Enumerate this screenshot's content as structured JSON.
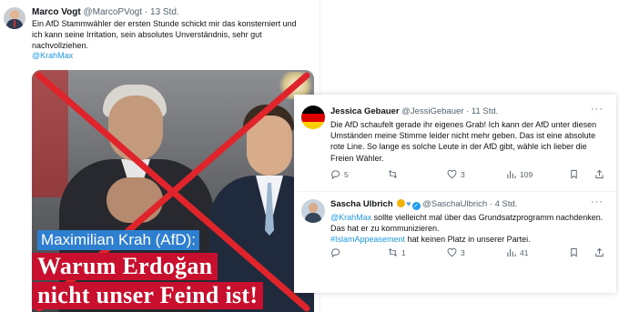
{
  "main_tweet": {
    "name": "Marco Vogt",
    "handle": "@MarcoPVogt",
    "time": "· 13 Std.",
    "text_lines": [
      "Ein AfD Stammwähler der ersten Stunde schickt mir das konsterniert und",
      "ich kann seine Irritation, sein absolutes Unverständnis, sehr gut",
      "nachvollziehen."
    ],
    "mention": "@KrahMax",
    "image": {
      "subtitle": "Maximilian Krah (AfD):",
      "headline_1": "Warum Erdoğan",
      "headline_2": "nicht unser Feind ist!",
      "cross_color": "#e0242b",
      "banner_red": "#c8102e",
      "banner_blue": "#2f7fd0"
    }
  },
  "replies": [
    {
      "name": "Jessica Gebauer",
      "handle": "@JessiGebauer",
      "time": "· 11 Std.",
      "avatar_icon": "german-flag-icon",
      "text_lines": [
        "Die AfD schaufelt gerade ihr eigenes Grab! Ich kann der AfD unter diesen",
        "Umständen meine Stimme leider nicht mehr geben. Das ist eine absolute",
        "rote Line. So lange es solche Leute in der AfD gibt, wähle ich lieber die",
        "Freien Wähler."
      ],
      "actions": {
        "replies": "5",
        "reposts": "",
        "likes": "3",
        "views": "109"
      }
    },
    {
      "name": "Sascha Ulbrich",
      "handle": "@SaschaUlbrich",
      "time": "· 4 Std.",
      "avatar_icon": "user-avatar-icon",
      "line1_mention": "@KrahMax",
      "line1_rest": " sollte vielleicht mal über das Grundsatzprogramm nachdenken.",
      "line2": "Das hat er zu kommunizieren.",
      "line3_hashtag": "#IslamAppeasement",
      "line3_rest": " hat keinen Platz in unserer Partei.",
      "actions": {
        "replies": "",
        "reposts": "1",
        "likes": "3",
        "views": "41"
      }
    }
  ],
  "colors": {
    "link": "#1d9bf0",
    "text": "#0f1419",
    "muted": "#536471"
  }
}
